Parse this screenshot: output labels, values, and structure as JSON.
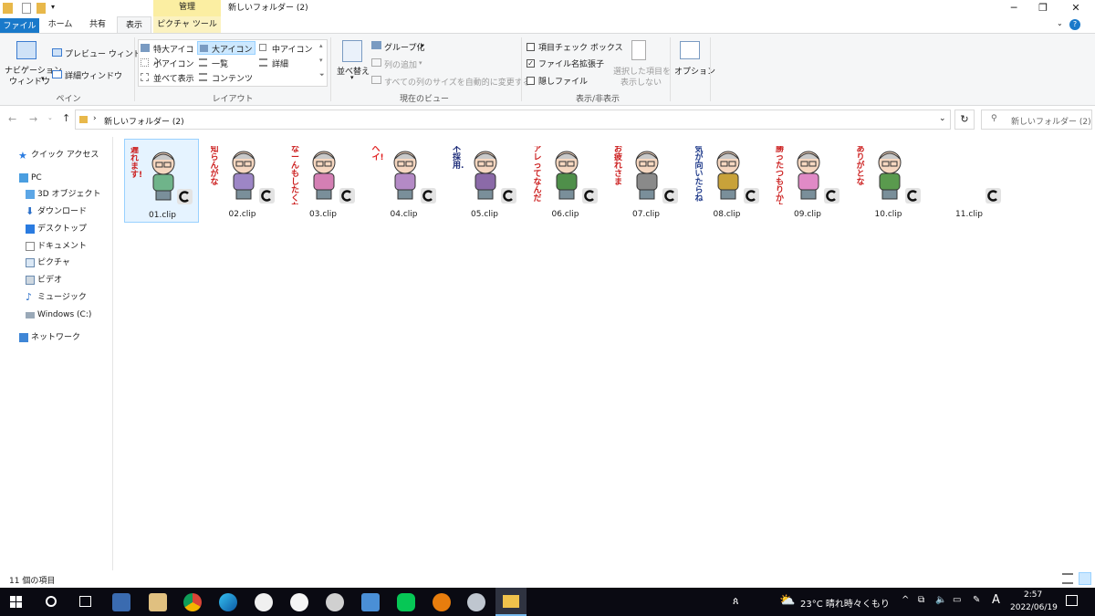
{
  "window": {
    "title": "新しいフォルダー (2)",
    "context_tab": "管理"
  },
  "tabs": {
    "file": "ファイル",
    "home": "ホーム",
    "share": "共有",
    "view": "表示",
    "picture_tools": "ピクチャ ツール"
  },
  "ribbon": {
    "pane": {
      "nav_pane": "ナビゲーション",
      "nav_pane_2": "ウィンドウ",
      "preview": "プレビュー ウィンドウ",
      "details": "詳細ウィンドウ",
      "label": "ペイン"
    },
    "layout": {
      "extra_large": "特大アイコン",
      "large": "大アイコン",
      "medium": "中アイコン",
      "small": "小アイコン",
      "list": "一覧",
      "details": "詳細",
      "tiles": "並べて表示",
      "content": "コンテンツ",
      "label": "レイアウト"
    },
    "current_view": {
      "sort": "並べ替え",
      "group": "グループ化",
      "add_column": "列の追加",
      "fit_columns": "すべての列のサイズを自動的に変更する",
      "label": "現在のビュー"
    },
    "show_hide": {
      "item_checkbox": "項目チェック ボックス",
      "extensions": "ファイル名拡張子",
      "hidden": "隠しファイル",
      "hide_selected_1": "選択した項目を",
      "hide_selected_2": "表示しない",
      "label": "表示/非表示"
    },
    "options": "オプション"
  },
  "address": {
    "path": "新しいフォルダー (2)",
    "search_placeholder": "新しいフォルダー (2)の..."
  },
  "sidebar": {
    "quick_access": "クイック アクセス",
    "pc": "PC",
    "items": [
      "3D オブジェクト",
      "ダウンロード",
      "デスクトップ",
      "ドキュメント",
      "ピクチャ",
      "ビデオ",
      "ミュージック",
      "Windows (C:)"
    ],
    "network": "ネットワーク"
  },
  "files": [
    {
      "name": "01.clip",
      "text": "遅れます!!",
      "text_color": "#cc1f1f",
      "shirt": "#6fb48a",
      "selected": true
    },
    {
      "name": "02.clip",
      "text": "知らんがな",
      "text_color": "#cc1f1f",
      "shirt": "#9d86c6"
    },
    {
      "name": "03.clip",
      "text": "なーんもしたくない",
      "text_color": "#cc1f1f",
      "shirt": "#d47fb4"
    },
    {
      "name": "04.clip",
      "text": "ヘイ!",
      "text_color": "#e02020",
      "shirt": "#b48ac6"
    },
    {
      "name": "05.clip",
      "text": "不採用.",
      "text_color": "#1f2e7a",
      "shirt": "#8b6aa8"
    },
    {
      "name": "06.clip",
      "text": "アレってなんだった",
      "text_color": "#cc1f1f",
      "shirt": "#4f8f4a"
    },
    {
      "name": "07.clip",
      "text": "お疲れさま",
      "text_color": "#cc1f1f",
      "shirt": "#8a8a8a"
    },
    {
      "name": "08.clip",
      "text": "気が向いたらね",
      "text_color": "#1f3a8a",
      "shirt": "#c8a23a"
    },
    {
      "name": "09.clip",
      "text": "勝ったつもりかよ",
      "text_color": "#cc1f1f",
      "shirt": "#e08ac6"
    },
    {
      "name": "10.clip",
      "text": "ありがとな",
      "text_color": "#cc1f1f",
      "shirt": "#5a9a4e"
    },
    {
      "name": "11.clip",
      "text": "",
      "text_color": "#cc1f1f",
      "shirt": ""
    }
  ],
  "status": {
    "count": "11 個の項目"
  },
  "taskbar": {
    "weather": "23°C  晴れ時々くもり",
    "ime": "A",
    "time": "2:57",
    "date": "2022/06/19"
  }
}
